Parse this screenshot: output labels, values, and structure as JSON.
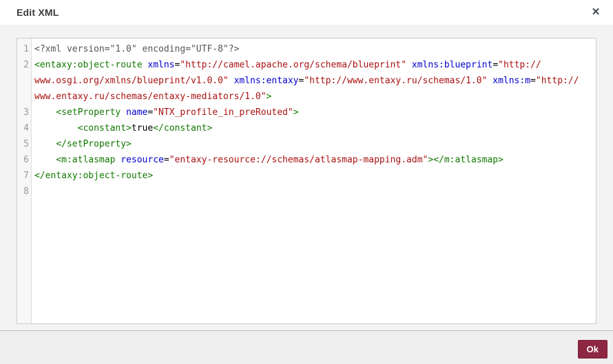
{
  "dialog": {
    "title": "Edit XML",
    "close_icon": "×"
  },
  "editor": {
    "token_colors": {
      "meta": "#555555",
      "tag": "#117700",
      "attr": "#0000cc",
      "string": "#aa1111",
      "plain": "#000000"
    },
    "gutter_color": "#999999",
    "lines": [
      {
        "num": "1",
        "rows": [
          [
            {
              "t": "meta",
              "s": "<?xml version=\"1.0\" encoding=\"UTF-8\"?>"
            }
          ]
        ]
      },
      {
        "num": "2",
        "rows": [
          [
            {
              "t": "tag",
              "s": "<entaxy:object-route"
            },
            {
              "t": "plain",
              "s": " "
            },
            {
              "t": "attr",
              "s": "xmlns"
            },
            {
              "t": "plain",
              "s": "="
            },
            {
              "t": "string",
              "s": "\"http://camel.apache.org/schema/blueprint\""
            },
            {
              "t": "plain",
              "s": " "
            },
            {
              "t": "attr",
              "s": "xmlns:blueprint"
            },
            {
              "t": "plain",
              "s": "="
            },
            {
              "t": "string",
              "s": "\"http://"
            }
          ],
          [
            {
              "t": "string",
              "s": "www.osgi.org/xmlns/blueprint/v1.0.0\""
            },
            {
              "t": "plain",
              "s": " "
            },
            {
              "t": "attr",
              "s": "xmlns:entaxy"
            },
            {
              "t": "plain",
              "s": "="
            },
            {
              "t": "string",
              "s": "\"http://www.entaxy.ru/schemas/1.0\""
            },
            {
              "t": "plain",
              "s": " "
            },
            {
              "t": "attr",
              "s": "xmlns:m"
            },
            {
              "t": "plain",
              "s": "="
            },
            {
              "t": "string",
              "s": "\"http://"
            }
          ],
          [
            {
              "t": "string",
              "s": "www.entaxy.ru/schemas/entaxy-mediators/1.0\""
            },
            {
              "t": "tag",
              "s": ">"
            }
          ]
        ]
      },
      {
        "num": "3",
        "rows": [
          [
            {
              "t": "plain",
              "s": "    "
            },
            {
              "t": "tag",
              "s": "<setProperty"
            },
            {
              "t": "plain",
              "s": " "
            },
            {
              "t": "attr",
              "s": "name"
            },
            {
              "t": "plain",
              "s": "="
            },
            {
              "t": "string",
              "s": "\"NTX_profile_in_preRouted\""
            },
            {
              "t": "tag",
              "s": ">"
            }
          ]
        ]
      },
      {
        "num": "4",
        "rows": [
          [
            {
              "t": "plain",
              "s": "        "
            },
            {
              "t": "tag",
              "s": "<constant>"
            },
            {
              "t": "plain",
              "s": "true"
            },
            {
              "t": "tag",
              "s": "</constant>"
            }
          ]
        ]
      },
      {
        "num": "5",
        "rows": [
          [
            {
              "t": "plain",
              "s": "    "
            },
            {
              "t": "tag",
              "s": "</setProperty>"
            }
          ]
        ]
      },
      {
        "num": "6",
        "rows": [
          [
            {
              "t": "plain",
              "s": "    "
            },
            {
              "t": "tag",
              "s": "<m:atlasmap"
            },
            {
              "t": "plain",
              "s": " "
            },
            {
              "t": "attr",
              "s": "resource"
            },
            {
              "t": "plain",
              "s": "="
            },
            {
              "t": "string",
              "s": "\"entaxy-resource://schemas/atlasmap-mapping.adm\""
            },
            {
              "t": "tag",
              "s": "></m:atlasmap>"
            }
          ]
        ]
      },
      {
        "num": "7",
        "rows": [
          [
            {
              "t": "tag",
              "s": "</entaxy:object-route>"
            }
          ]
        ]
      },
      {
        "num": "8",
        "rows": [
          []
        ]
      }
    ]
  },
  "footer": {
    "ok_label": "Ok",
    "ok_color": "#8e2742"
  }
}
